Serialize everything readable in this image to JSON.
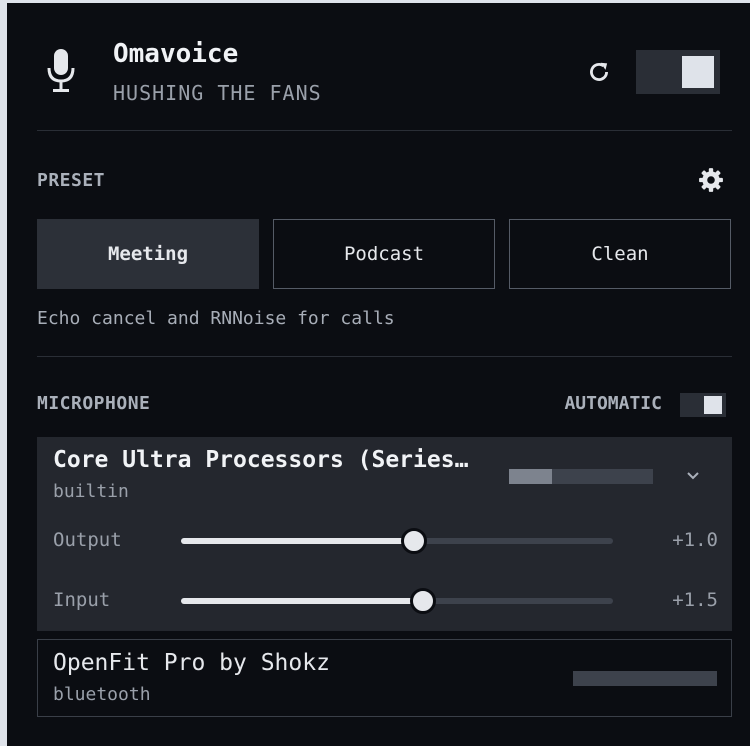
{
  "app": {
    "title": "Omavoice",
    "subtitle": "HUSHING THE FANS",
    "enabled": true
  },
  "preset": {
    "section_label": "PRESET",
    "buttons": [
      {
        "label": "Meeting",
        "active": true
      },
      {
        "label": "Podcast",
        "active": false
      },
      {
        "label": "Clean",
        "active": false
      }
    ],
    "description": "Echo cancel and RNNoise for calls"
  },
  "microphone": {
    "section_label": "MICROPHONE",
    "automatic_label": "AUTOMATIC",
    "automatic_on": true,
    "devices": [
      {
        "name": "Core Ultra Processors (Series…",
        "type": "builtin",
        "level": 0.3,
        "sliders": [
          {
            "label": "Output",
            "value": "+1.0",
            "position": 0.54
          },
          {
            "label": "Input",
            "value": "+1.5",
            "position": 0.56
          }
        ]
      },
      {
        "name": "OpenFit Pro by Shokz",
        "type": "bluetooth",
        "level": 0.0
      }
    ]
  },
  "colors": {
    "background": "#0b0d12",
    "card": "#24272e",
    "accent": "#dfe3ea",
    "muted": "#9aa0aa"
  },
  "icons": [
    "microphone-icon",
    "refresh-icon",
    "gear-icon",
    "chevron-down-icon"
  ]
}
